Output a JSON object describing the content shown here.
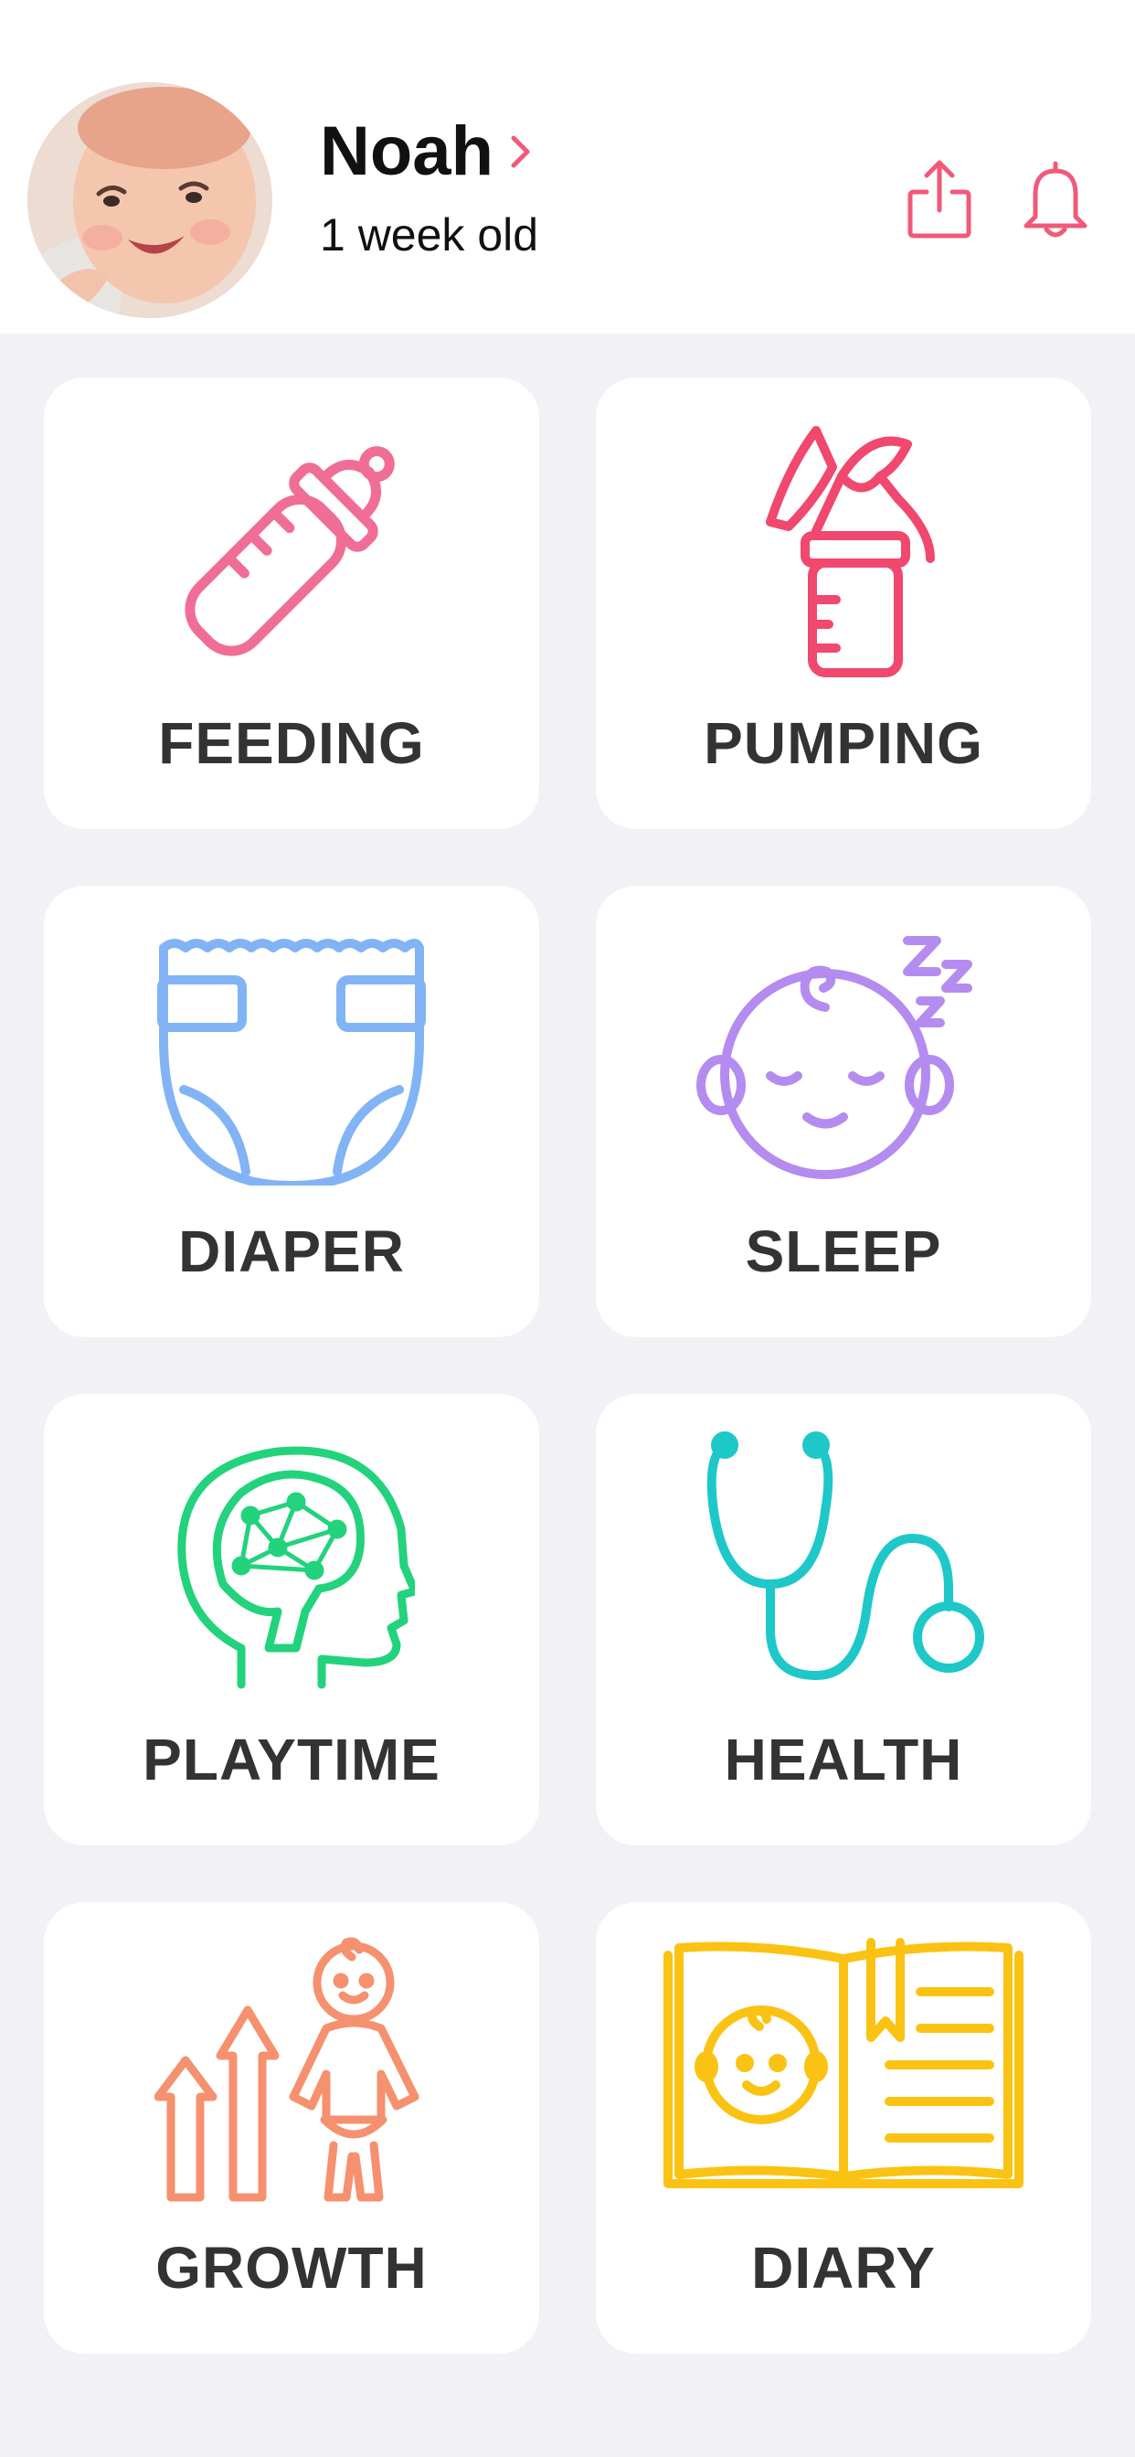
{
  "profile": {
    "name": "Noah",
    "age": "1 week old"
  },
  "header_icons": {
    "share": "share-icon",
    "notifications": "bell-icon",
    "accent_color": "#f05a78"
  },
  "tiles": [
    {
      "label": "FEEDING",
      "icon": "baby-bottle-icon",
      "color": "#f06e96"
    },
    {
      "label": "PUMPING",
      "icon": "breast-pump-icon",
      "color": "#f0486e"
    },
    {
      "label": "DIAPER",
      "icon": "diaper-icon",
      "color": "#82b4f5"
    },
    {
      "label": "SLEEP",
      "icon": "sleeping-baby-icon",
      "color": "#b48cf0"
    },
    {
      "label": "PLAYTIME",
      "icon": "brain-icon",
      "color": "#23d27d"
    },
    {
      "label": "HEALTH",
      "icon": "stethoscope-icon",
      "color": "#1ec8c8"
    },
    {
      "label": "GROWTH",
      "icon": "growth-icon",
      "color": "#f5916e"
    },
    {
      "label": "DIARY",
      "icon": "diary-book-icon",
      "color": "#fac314"
    }
  ],
  "colors": {
    "background": "#f1f1f6",
    "card": "#ffffff",
    "label_text": "#333333"
  }
}
